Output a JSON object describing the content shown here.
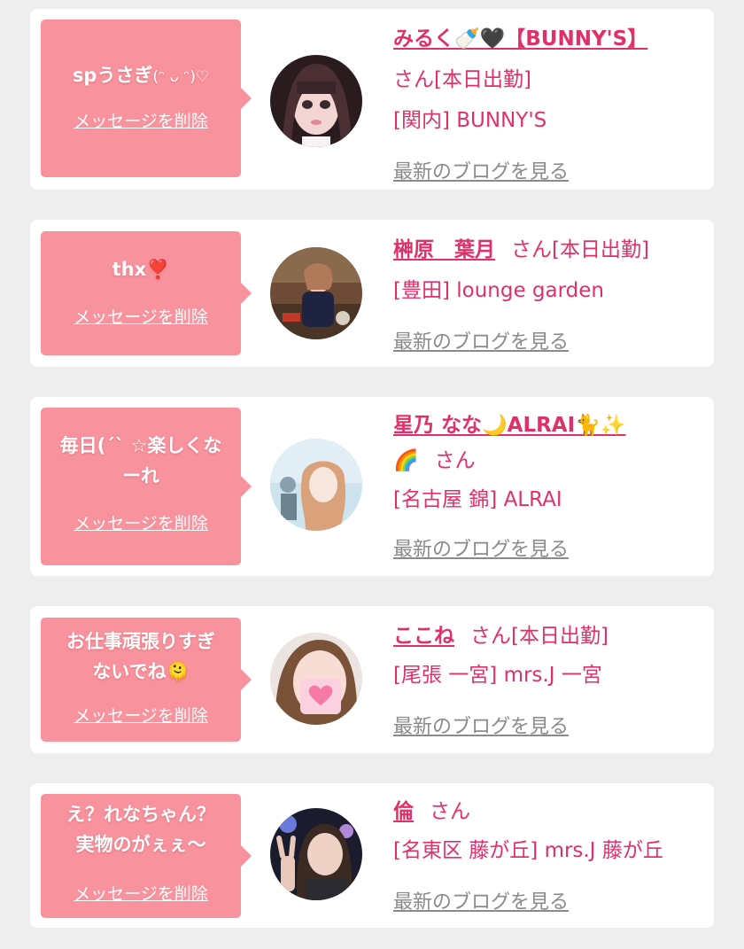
{
  "delete_label": "メッセージを削除",
  "blog_label": "最新のブログを見る",
  "colors": {
    "background": "#eeeeee",
    "card": "#ffffff",
    "bubble": "#f8929c",
    "accent": "#e0306a",
    "link_gray": "#8a8a8a"
  },
  "cards": [
    {
      "message": "spうさぎ",
      "message_kaomoji": "(ᵔ ᴗ ᵔ)♡",
      "name": "みるく🍼🖤【BUNNY'S】",
      "san": "さん",
      "status": "[本日出勤]",
      "shop": "[関内] BUNNY'S"
    },
    {
      "message": "thx❣️",
      "name": "榊原　葉月",
      "san": "さん",
      "status": "[本日出勤]",
      "shop": "[豊田] lounge garden"
    },
    {
      "message_line1": "毎日(ˊˋ ☆楽しくな",
      "message_line2": "ーれ",
      "name": "星乃 なな🌙ALRAI🐈✨",
      "name_line2": "🌈",
      "san": "さん",
      "status": "",
      "shop": "[名古屋 錦] ALRAI"
    },
    {
      "message_line1": "お仕事頑張りすぎ",
      "message_line2": "ないでね🫠",
      "name": "ここね",
      "san": "さん",
      "status": "[本日出勤]",
      "shop": "[尾張 一宮] mrs.J 一宮"
    },
    {
      "message_line1": "え？れなちゃん？",
      "message_line2": "実物のがぇぇ〜",
      "name": "倫",
      "san": "さん",
      "status": "",
      "shop": "[名東区 藤が丘] mrs.J 藤が丘"
    }
  ]
}
